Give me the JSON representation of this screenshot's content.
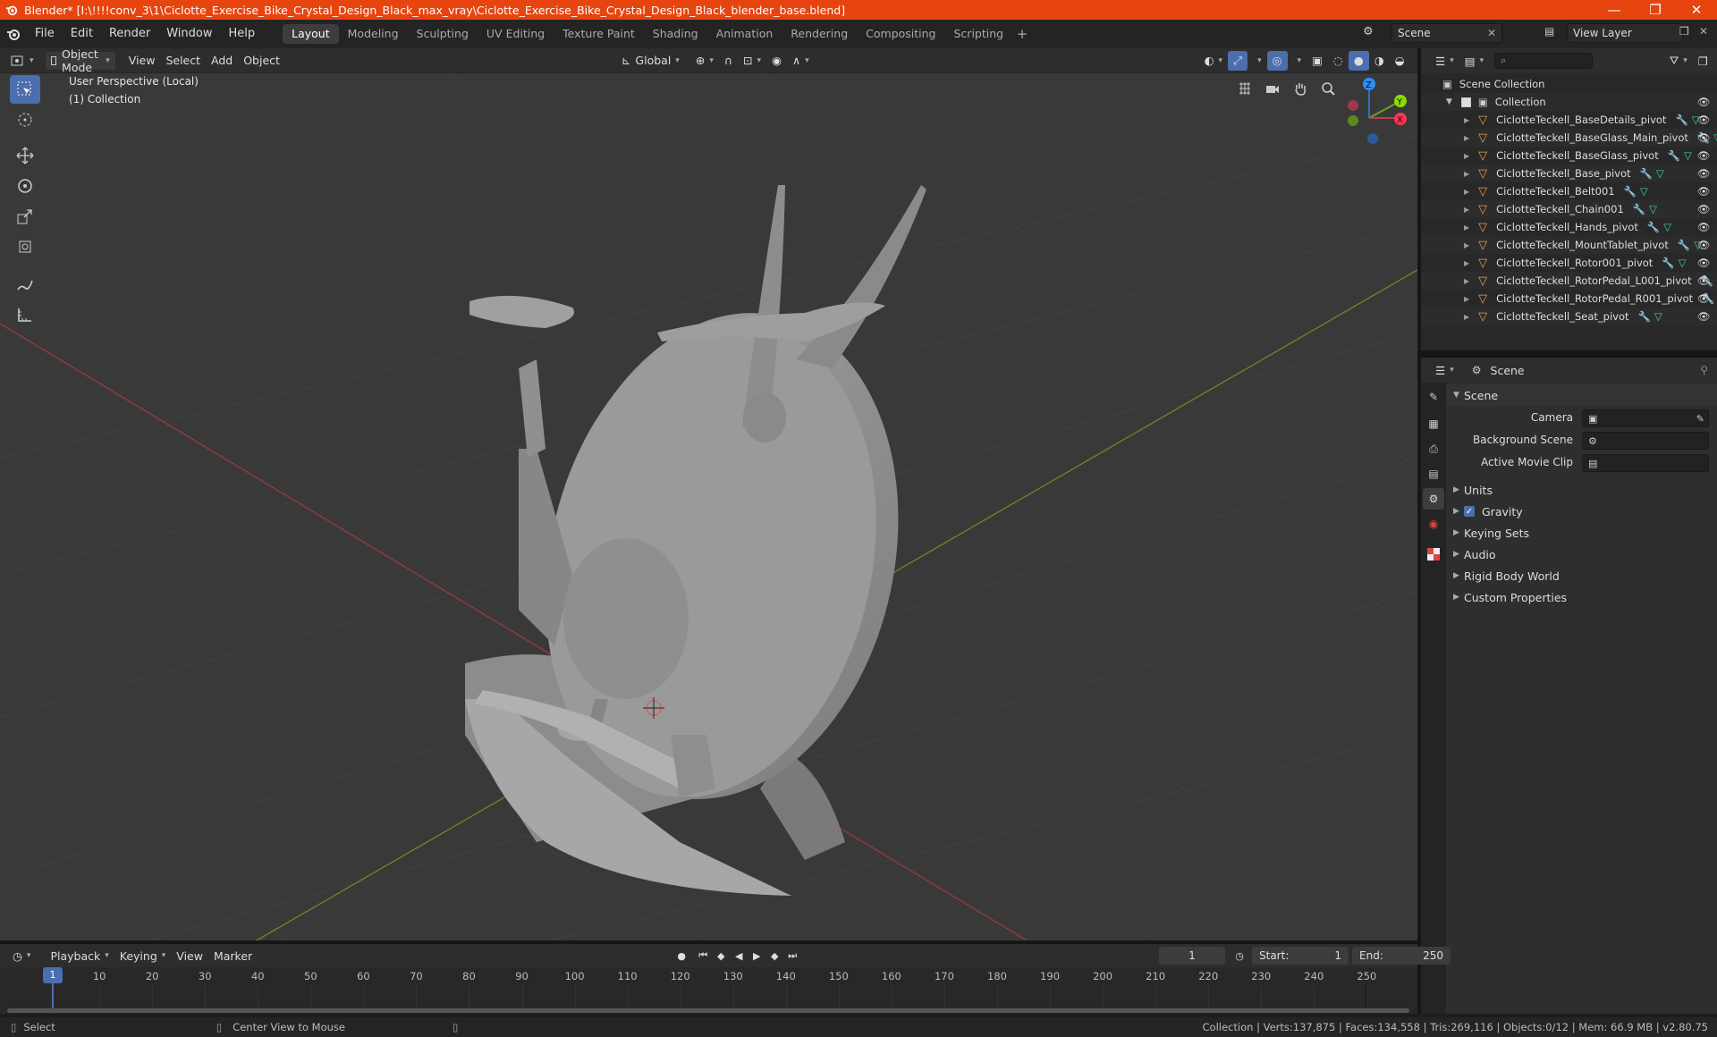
{
  "window": {
    "title": "Blender* [I:\\!!!!conv_3\\1\\Ciclotte_Exercise_Bike_Crystal_Design_Black_max_vray\\Ciclotte_Exercise_Bike_Crystal_Design_Black_blender_base.blend]",
    "controls": [
      "—",
      "❐",
      "✕"
    ]
  },
  "menu": [
    "File",
    "Edit",
    "Render",
    "Window",
    "Help"
  ],
  "workspaces": [
    "Layout",
    "Modeling",
    "Sculpting",
    "UV Editing",
    "Texture Paint",
    "Shading",
    "Animation",
    "Rendering",
    "Compositing",
    "Scripting"
  ],
  "active_workspace": "Layout",
  "scene_name": "Scene",
  "view_layer": "View Layer",
  "viewport": {
    "mode": "Object Mode",
    "menus": [
      "View",
      "Select",
      "Add",
      "Object"
    ],
    "transform_orientation": "Global",
    "perspective_label": "User Perspective (Local)",
    "collection_label": "(1) Collection",
    "gizmo": {
      "x": "X",
      "y": "Y",
      "z": "Z"
    }
  },
  "outliner": {
    "root": "Scene Collection",
    "collection": "Collection",
    "items": [
      "CiclotteTeckell_BaseDetails_pivot",
      "CiclotteTeckell_BaseGlass_Main_pivot",
      "CiclotteTeckell_BaseGlass_pivot",
      "CiclotteTeckell_Base_pivot",
      "CiclotteTeckell_Belt001",
      "CiclotteTeckell_Chain001",
      "CiclotteTeckell_Hands_pivot",
      "CiclotteTeckell_MountTablet_pivot",
      "CiclotteTeckell_Rotor001_pivot",
      "CiclotteTeckell_RotorPedal_L001_pivot",
      "CiclotteTeckell_RotorPedal_R001_pivot",
      "CiclotteTeckell_Seat_pivot"
    ]
  },
  "properties": {
    "header": "Scene",
    "section": "Scene",
    "fields": [
      {
        "label": "Camera"
      },
      {
        "label": "Background Scene"
      },
      {
        "label": "Active Movie Clip"
      }
    ],
    "panels": [
      "Units",
      "Gravity",
      "Keying Sets",
      "Audio",
      "Rigid Body World",
      "Custom Properties"
    ]
  },
  "timeline": {
    "menus": [
      "Playback",
      "Keying",
      "View",
      "Marker"
    ],
    "current_frame": "1",
    "start_label": "Start:",
    "start": "1",
    "end_label": "End:",
    "end": "250",
    "ticks": [
      "1",
      "10",
      "20",
      "30",
      "40",
      "50",
      "60",
      "70",
      "80",
      "90",
      "100",
      "110",
      "120",
      "130",
      "140",
      "150",
      "160",
      "170",
      "180",
      "190",
      "200",
      "210",
      "220",
      "230",
      "240",
      "250"
    ]
  },
  "status": {
    "left": "Select",
    "middle": "Center View to Mouse",
    "right": "Collection | Verts:137,875 | Faces:134,558 | Tris:269,116 | Objects:0/12 | Mem: 66.9 MB | v2.80.75"
  },
  "colors": {
    "accent": "#e8440f",
    "selection": "#4b6eae",
    "x_axis": "#ff3352",
    "y_axis": "#8bdc00",
    "z_axis": "#2890ff"
  }
}
